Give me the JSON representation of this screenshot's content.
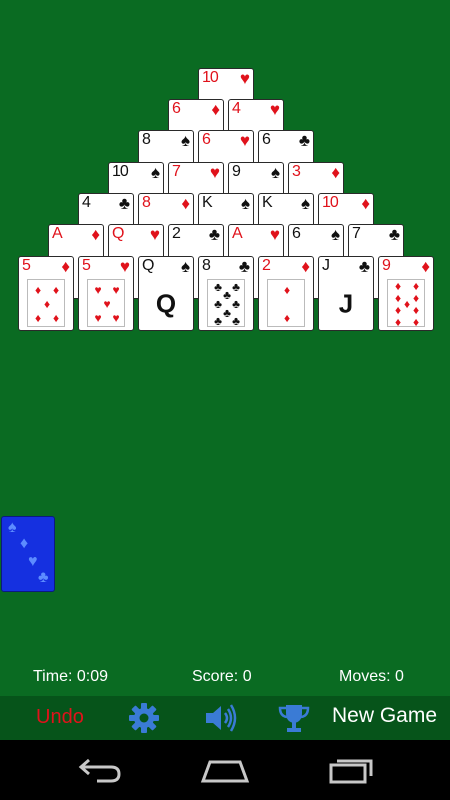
{
  "pyramid": [
    {
      "rank": "10",
      "suit": "♥",
      "color": "red"
    },
    {
      "rank": "6",
      "suit": "♦",
      "color": "red"
    },
    {
      "rank": "4",
      "suit": "♥",
      "color": "red"
    },
    {
      "rank": "8",
      "suit": "♠",
      "color": "black"
    },
    {
      "rank": "6",
      "suit": "♥",
      "color": "red"
    },
    {
      "rank": "6",
      "suit": "♣",
      "color": "black"
    },
    {
      "rank": "10",
      "suit": "♠",
      "color": "black"
    },
    {
      "rank": "7",
      "suit": "♥",
      "color": "red"
    },
    {
      "rank": "9",
      "suit": "♠",
      "color": "black"
    },
    {
      "rank": "3",
      "suit": "♦",
      "color": "red"
    },
    {
      "rank": "4",
      "suit": "♣",
      "color": "black"
    },
    {
      "rank": "8",
      "suit": "♦",
      "color": "red"
    },
    {
      "rank": "K",
      "suit": "♠",
      "color": "black"
    },
    {
      "rank": "K",
      "suit": "♠",
      "color": "black"
    },
    {
      "rank": "10",
      "suit": "♦",
      "color": "red"
    },
    {
      "rank": "A",
      "suit": "♦",
      "color": "red"
    },
    {
      "rank": "Q",
      "suit": "♥",
      "color": "red"
    },
    {
      "rank": "2",
      "suit": "♣",
      "color": "black"
    },
    {
      "rank": "A",
      "suit": "♥",
      "color": "red"
    },
    {
      "rank": "6",
      "suit": "♠",
      "color": "black"
    },
    {
      "rank": "7",
      "suit": "♣",
      "color": "black"
    },
    {
      "rank": "5",
      "suit": "♦",
      "color": "red"
    },
    {
      "rank": "5",
      "suit": "♥",
      "color": "red"
    },
    {
      "rank": "Q",
      "suit": "♠",
      "color": "black"
    },
    {
      "rank": "8",
      "suit": "♣",
      "color": "black"
    },
    {
      "rank": "2",
      "suit": "♦",
      "color": "red"
    },
    {
      "rank": "J",
      "suit": "♣",
      "color": "black"
    },
    {
      "rank": "9",
      "suit": "♦",
      "color": "red"
    }
  ],
  "stats": {
    "time": "Time: 0:09",
    "score": "Score: 0",
    "moves": "Moves: 0"
  },
  "toolbar": {
    "undo": "Undo",
    "new_game": "New Game",
    "icons": [
      "gear-icon",
      "sound-icon",
      "trophy-icon"
    ]
  },
  "navbar": {
    "icons": [
      "back-icon",
      "home-icon",
      "recent-apps-icon"
    ]
  },
  "colors": {
    "felt": "#0a6b22",
    "toolbar": "#06541a",
    "red_suit": "#e0121b",
    "card_back": "#1530e0",
    "icon_blue": "#3a7bd5"
  }
}
